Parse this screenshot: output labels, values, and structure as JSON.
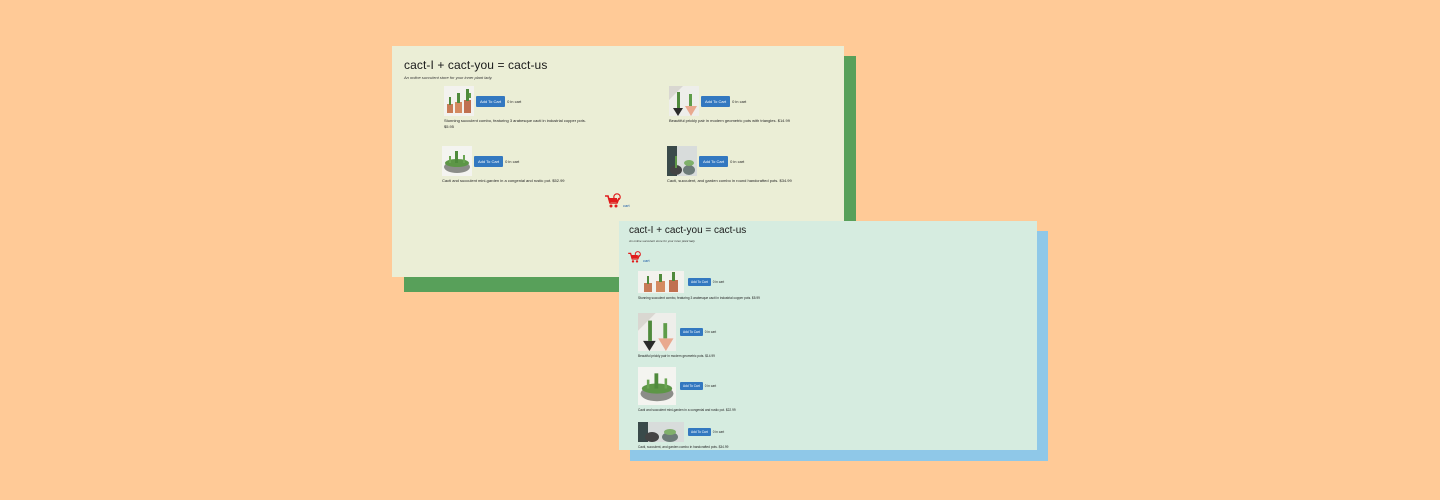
{
  "desktop": {
    "title": "cact-I + cact-you = cact-us",
    "subtitle": "An online succulent store for your inner plant lady.",
    "cart_label": "cart",
    "products": [
      {
        "button": "Add To Cart",
        "count": "0 in cart",
        "description": "Stunning succulent combo, featuring 3 arabesque cacti in industrial copper pots. $5.95"
      },
      {
        "button": "Add To Cart",
        "count": "0 in cart",
        "description": "Beautiful prickly pair in modern geometric pots with triangles. $14.99"
      },
      {
        "button": "Add To Cart",
        "count": "0 in cart",
        "description": "Cacti and succulent mini-garden in a congenial and rustic pot. $52.99"
      },
      {
        "button": "Add To Cart",
        "count": "0 in cart",
        "description": "Cacti, succulent, and garden combo in round handcrafted pots. $34.99"
      }
    ]
  },
  "mobile": {
    "title": "cact-I + cact-you = cact-us",
    "subtitle": "An online succulent store for your inner plant lady.",
    "cart_label": "cart",
    "products": [
      {
        "button": "Add To Cart",
        "count": "0 in cart",
        "description": "Stunning succulent combo, featuring 3 arabesque cacti in industrial copper pots. $5.99"
      },
      {
        "button": "Add To Cart",
        "count": "0 in cart",
        "description": "Beautiful prickly pair in modern geometric pots. $14.99"
      },
      {
        "button": "Add To Cart",
        "count": "0 in cart",
        "description": "Cacti and succulent mini-garden in a congenial and rustic pot. $22.99"
      },
      {
        "button": "Add To Cart",
        "count": "0 in cart",
        "description": "Cacti, succulent, and garden combo in handcrafted pots. $34.99"
      }
    ]
  },
  "colors": {
    "background": "#FFCA97",
    "desktop_card": "#EBEED6",
    "desktop_shadow": "#58A05A",
    "mobile_card": "#D6ECE0",
    "mobile_shadow": "#8FC8E8",
    "button": "#3378C0",
    "cart_icon": "#E01B1B"
  },
  "icons": {
    "cart": "shopping-cart-icon"
  }
}
